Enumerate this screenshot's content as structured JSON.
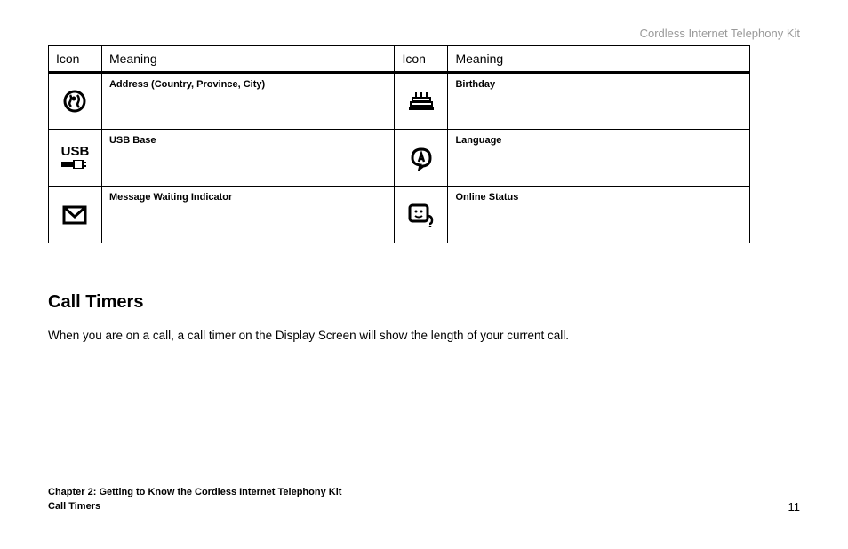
{
  "header": {
    "product_name": "Cordless  Internet Telephony Kit"
  },
  "table": {
    "headers": {
      "icon1": "Icon",
      "meaning1": "Meaning",
      "icon2": "Icon",
      "meaning2": "Meaning"
    },
    "rows": [
      {
        "meaning1": "Address (Country, Province, City)",
        "meaning2": "Birthday"
      },
      {
        "meaning1": "USB Base",
        "meaning2": "Language"
      },
      {
        "meaning1": "Message Waiting Indicator",
        "meaning2": "Online Status"
      }
    ]
  },
  "section": {
    "heading": "Call Timers",
    "body": "When you are on a call, a call timer on the Display Screen will show the length of your current call."
  },
  "footer": {
    "chapter": "Chapter 2: Getting to Know the Cordless Internet Telephony Kit",
    "subsection": "Call Timers",
    "page": "11"
  }
}
